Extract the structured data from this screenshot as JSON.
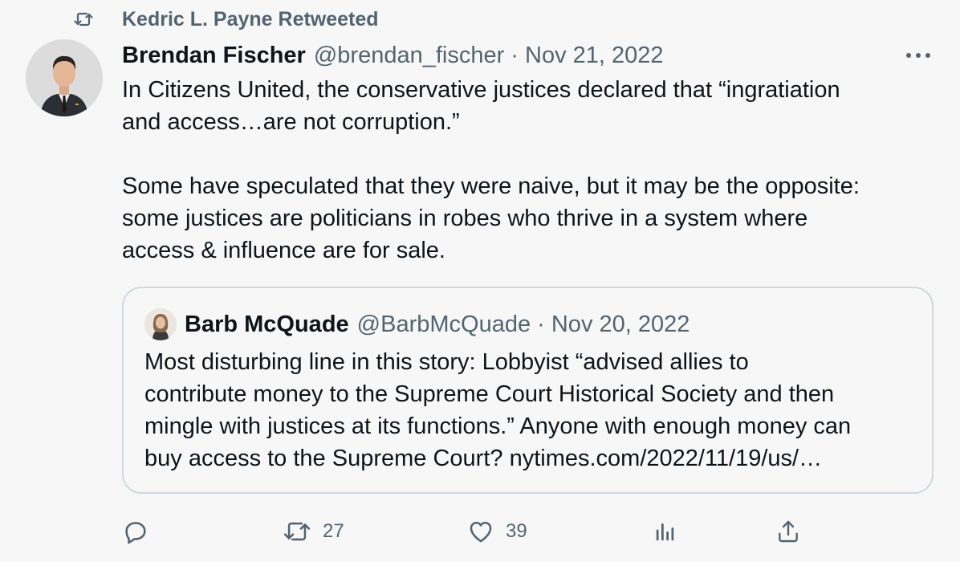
{
  "retweet": {
    "icon": "retweet-icon",
    "label": "Kedric L. Payne Retweeted"
  },
  "tweet": {
    "author_name": "Brendan Fischer",
    "meta": "@brendan_fischer · Nov 21, 2022",
    "more_icon": "more-icon",
    "text_lines": [
      "In Citizens United, the conservative justices declared that “ingratiation",
      "and access…are not corruption.”",
      "",
      "Some have speculated that they were naive, but it may be the opposite:",
      "some justices are politicians in robes who thrive in a system where",
      "access & influence are for sale."
    ]
  },
  "quote": {
    "author_name": "Barb McQuade",
    "meta": "@BarbMcQuade · Nov 20, 2022",
    "text_lines": [
      "Most disturbing line in this story: Lobbyist “advised allies to",
      "contribute money to the Supreme Court Historical Society and then",
      "mingle with justices at its functions.” Anyone with enough money can",
      "buy access to the Supreme Court?  nytimes.com/2022/11/19/us/…"
    ]
  },
  "actions": {
    "reply": {
      "icon": "reply-icon"
    },
    "retweet": {
      "icon": "retweet-icon",
      "count": "27"
    },
    "like": {
      "icon": "heart-icon",
      "count": "39"
    },
    "views": {
      "icon": "views-icon"
    },
    "share": {
      "icon": "share-icon"
    }
  },
  "colors": {
    "background": "#f7f7f7",
    "text": "#0f1419",
    "secondary": "#536471",
    "border": "#cfd9de"
  }
}
